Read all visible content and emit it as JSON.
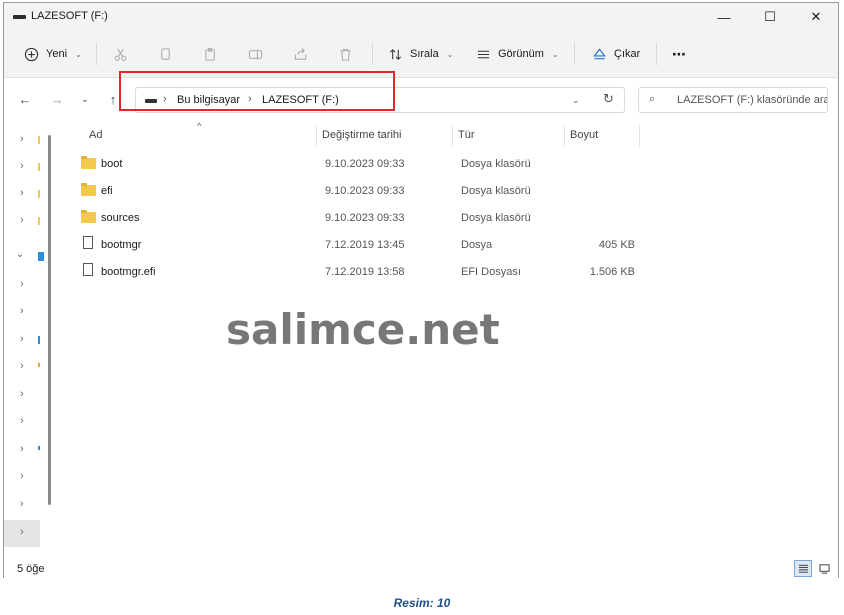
{
  "window": {
    "title": "LAZESOFT (F:)",
    "controls": {
      "minimize": "—",
      "maximize": "☐",
      "close": "✕"
    }
  },
  "toolbar": {
    "new_label": "Yeni",
    "sort_label": "Sırala",
    "view_label": "Görünüm",
    "eject_label": "Çıkar",
    "more_label": "⋯"
  },
  "address": {
    "crumbs": [
      "Bu bilgisayar",
      "LAZESOFT (F:)"
    ],
    "search_placeholder": "LAZESOFT (F:) klasöründe ara"
  },
  "columns": {
    "name": "Ad",
    "modified": "Değiştirme tarihi",
    "type": "Tür",
    "size": "Boyut"
  },
  "files": [
    {
      "name": "boot",
      "modified": "9.10.2023 09:33",
      "type": "Dosya klasörü",
      "size": "",
      "kind": "folder"
    },
    {
      "name": "efi",
      "modified": "9.10.2023 09:33",
      "type": "Dosya klasörü",
      "size": "",
      "kind": "folder"
    },
    {
      "name": "sources",
      "modified": "9.10.2023 09:33",
      "type": "Dosya klasörü",
      "size": "",
      "kind": "folder"
    },
    {
      "name": "bootmgr",
      "modified": "7.12.2019 13:45",
      "type": "Dosya",
      "size": "405 KB",
      "kind": "file"
    },
    {
      "name": "bootmgr.efi",
      "modified": "7.12.2019 13:58",
      "type": "EFI Dosyası",
      "size": "1.506 KB",
      "kind": "file"
    }
  ],
  "status": {
    "count": "5 öğe"
  },
  "watermark": "salimce.net",
  "caption": "Resim: 10",
  "colors": {
    "highlight": "#e8242a",
    "folder": "#f2c94c",
    "caption": "#1f4f8a"
  }
}
